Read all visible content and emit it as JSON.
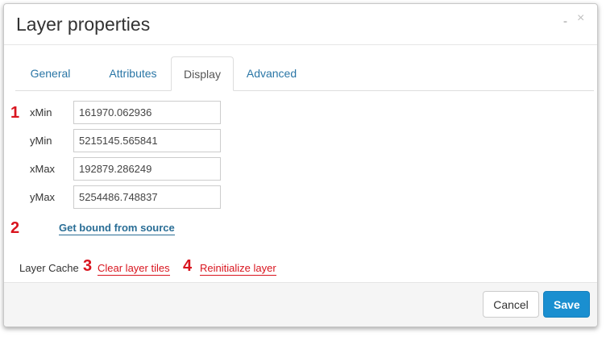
{
  "dialog": {
    "title": "Layer properties",
    "minimize_label": "-",
    "close_label": "×"
  },
  "tabs": [
    {
      "label": "General",
      "active": false
    },
    {
      "label": "Attributes",
      "active": false
    },
    {
      "label": "Display",
      "active": true
    },
    {
      "label": "Advanced",
      "active": false
    }
  ],
  "markers": [
    "1",
    "2",
    "3",
    "4"
  ],
  "bounds": {
    "xmin": {
      "label": "xMin",
      "value": "161970.062936"
    },
    "ymin": {
      "label": "yMin",
      "value": "5215145.565841"
    },
    "xmax": {
      "label": "xMax",
      "value": "192879.286249"
    },
    "ymax": {
      "label": "yMax",
      "value": "5254486.748837"
    }
  },
  "get_bound_label": "Get bound from source",
  "cache": {
    "label": "Layer Cache",
    "clear_label": "Clear layer tiles",
    "reinit_label": "Reinitialize layer"
  },
  "footer": {
    "cancel_label": "Cancel",
    "save_label": "Save"
  },
  "colors": {
    "accent": "#1a8fd0",
    "link": "#2a76a6",
    "marker": "#d9141e"
  }
}
